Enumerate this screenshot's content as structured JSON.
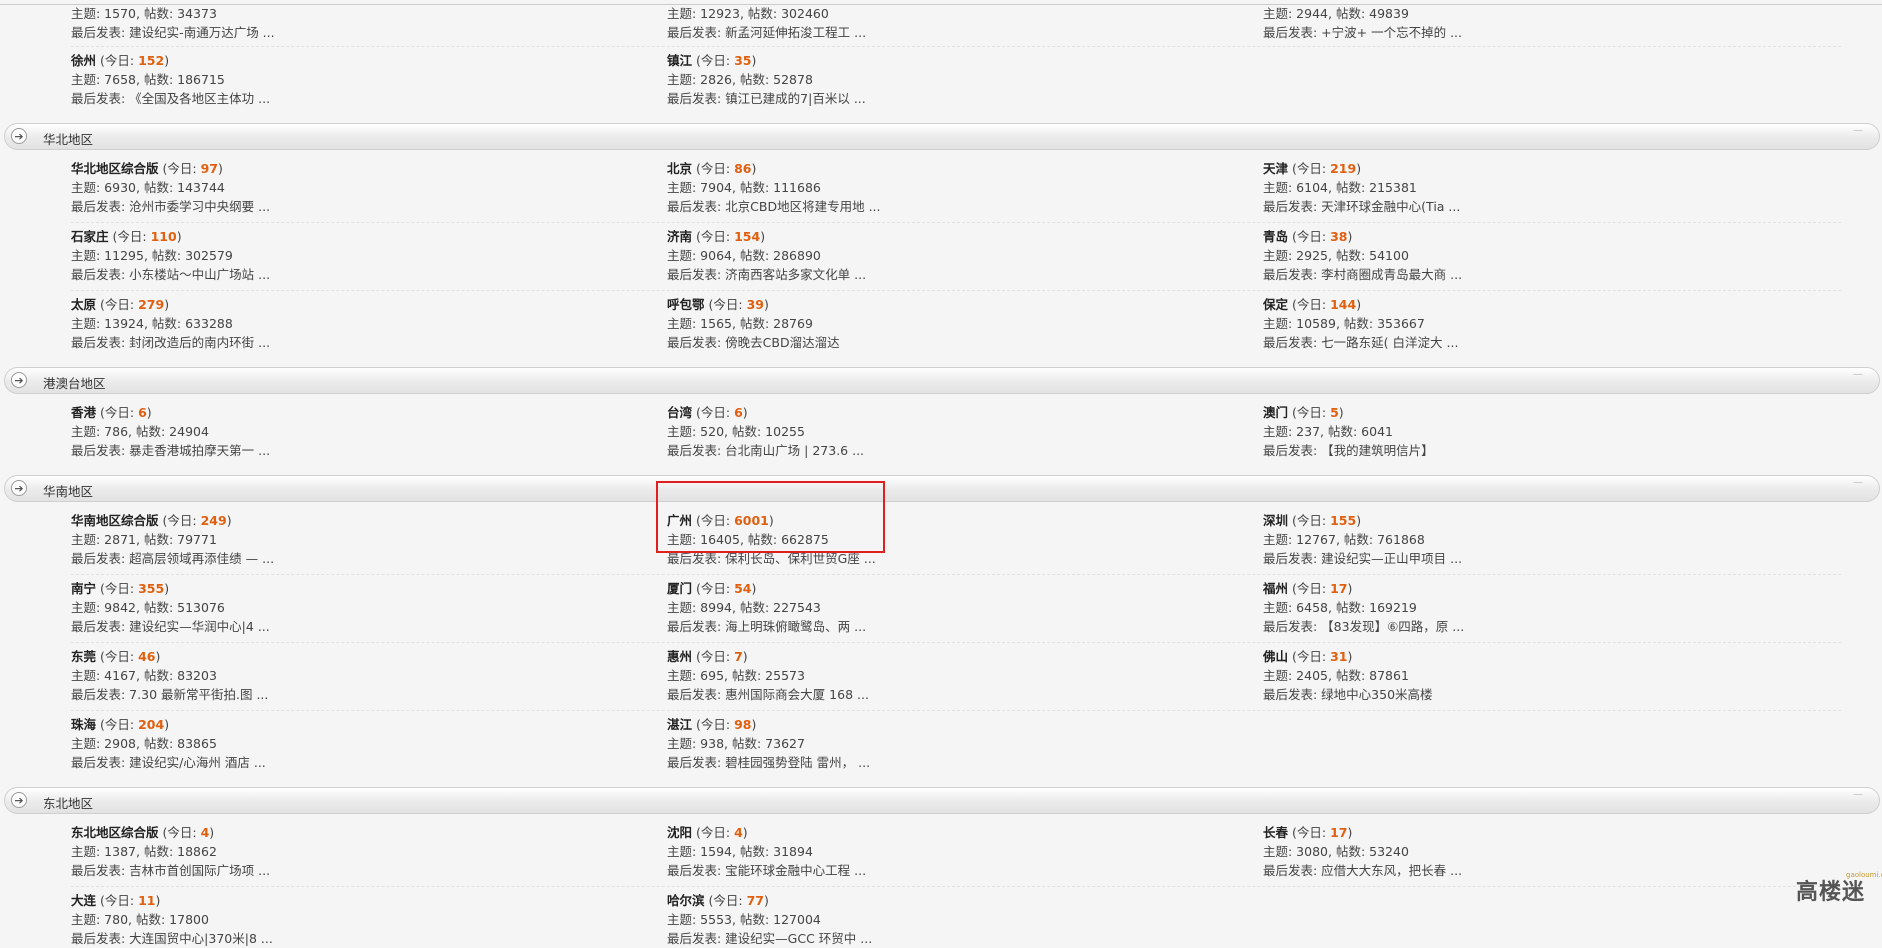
{
  "top_rows": [
    {
      "stats": "主题: 1570, 帖数: 34373",
      "last": "最后发表: 建设纪实-南通万达广场 ..."
    },
    {
      "stats": "主题: 12923, 帖数: 302460",
      "last": "最后发表: 新孟河延伸拓浚工程工 ..."
    },
    {
      "stats": "主题: 2944, 帖数: 49839",
      "last": "最后发表: +宁波+ 一个忘不掉的 ..."
    }
  ],
  "regions": [
    {
      "title": "",
      "forums": [
        {
          "name": "徐州",
          "today_count": "152",
          "stats": "主题: 7658, 帖数: 186715",
          "last": "最后发表: 《全国及各地区主体功 ..."
        },
        {
          "name": "镇江",
          "today_count": "35",
          "stats": "主题: 2826, 帖数: 52878",
          "last": "最后发表: 镇江已建成的7|百米以 ..."
        }
      ]
    },
    {
      "title": "华北地区",
      "forums": [
        {
          "name": "华北地区综合版",
          "today_count": "97",
          "stats": "主题: 6930, 帖数: 143744",
          "last": "最后发表: 沧州市委学习中央纲要 ..."
        },
        {
          "name": "北京",
          "today_count": "86",
          "stats": "主题: 7904, 帖数: 111686",
          "last": "最后发表: 北京CBD地区将建专用地 ..."
        },
        {
          "name": "天津",
          "today_count": "219",
          "stats": "主题: 6104, 帖数: 215381",
          "last": "最后发表: 天津环球金融中心(Tia ..."
        },
        {
          "name": "石家庄",
          "today_count": "110",
          "stats": "主题: 11295, 帖数: 302579",
          "last": "最后发表: 小东楼站～中山广场站 ..."
        },
        {
          "name": "济南",
          "today_count": "154",
          "stats": "主题: 9064, 帖数: 286890",
          "last": "最后发表: 济南西客站多家文化单 ..."
        },
        {
          "name": "青岛",
          "today_count": "38",
          "stats": "主题: 2925, 帖数: 54100",
          "last": "最后发表: 李村商圈成青岛最大商 ..."
        },
        {
          "name": "太原",
          "today_count": "279",
          "stats": "主题: 13924, 帖数: 633288",
          "last": "最后发表: 封闭改造后的南内环街 ..."
        },
        {
          "name": "呼包鄂",
          "today_count": "39",
          "stats": "主题: 1565, 帖数: 28769",
          "last": "最后发表: 傍晚去CBD溜达溜达"
        },
        {
          "name": "保定",
          "today_count": "144",
          "stats": "主题: 10589, 帖数: 353667",
          "last": "最后发表: 七一路东延( 白洋淀大 ..."
        }
      ]
    },
    {
      "title": "港澳台地区",
      "forums": [
        {
          "name": "香港",
          "today_count": "6",
          "stats": "主题: 786, 帖数: 24904",
          "last": "最后发表: 暴走香港城拍摩天第一 ..."
        },
        {
          "name": "台湾",
          "today_count": "6",
          "stats": "主题: 520, 帖数: 10255",
          "last": "最后发表: 台北南山广场 | 273.6 ..."
        },
        {
          "name": "澳门",
          "today_count": "5",
          "stats": "主题: 237, 帖数: 6041",
          "last": "最后发表: 【我的建筑明信片】"
        }
      ]
    },
    {
      "title": "华南地区",
      "forums": [
        {
          "name": "华南地区综合版",
          "today_count": "249",
          "stats": "主题: 2871, 帖数: 79771",
          "last": "最后发表: 超高层领域再添佳绩 — ..."
        },
        {
          "name": "广州",
          "today_count": "6001",
          "stats": "主题: 16405, 帖数: 662875",
          "last": "最后发表: 保利长岛、保利世贸G座 ..."
        },
        {
          "name": "深圳",
          "today_count": "155",
          "stats": "主题: 12767, 帖数: 761868",
          "last": "最后发表: 建设纪实—正山甲项目 ..."
        },
        {
          "name": "南宁",
          "today_count": "355",
          "stats": "主题: 9842, 帖数: 513076",
          "last": "最后发表: 建设纪实—华润中心|4 ..."
        },
        {
          "name": "厦门",
          "today_count": "54",
          "stats": "主题: 8994, 帖数: 227543",
          "last": "最后发表: 海上明珠俯瞰鹭岛、两 ..."
        },
        {
          "name": "福州",
          "today_count": "17",
          "stats": "主题: 6458, 帖数: 169219",
          "last": "最后发表: 【83发现】⑥四路，原 ..."
        },
        {
          "name": "东莞",
          "today_count": "46",
          "stats": "主题: 4167, 帖数: 83203",
          "last": "最后发表: 7.30 最新常平街拍.图 ..."
        },
        {
          "name": "惠州",
          "today_count": "7",
          "stats": "主题: 695, 帖数: 25573",
          "last": "最后发表: 惠州国际商会大厦 168 ..."
        },
        {
          "name": "佛山",
          "today_count": "31",
          "stats": "主题: 2405, 帖数: 87861",
          "last": "最后发表: 绿地中心350米高楼"
        },
        {
          "name": "珠海",
          "today_count": "204",
          "stats": "主题: 2908, 帖数: 83865",
          "last": "最后发表: 建设纪实/心海州 酒店 ..."
        },
        {
          "name": "湛江",
          "today_count": "98",
          "stats": "主题: 938, 帖数: 73627",
          "last": "最后发表: 碧桂园强势登陆 雷州， ..."
        }
      ]
    },
    {
      "title": "东北地区",
      "forums": [
        {
          "name": "东北地区综合版",
          "today_count": "4",
          "stats": "主题: 1387, 帖数: 18862",
          "last": "最后发表: 吉林市首创国际广场项 ..."
        },
        {
          "name": "沈阳",
          "today_count": "4",
          "stats": "主题: 1594, 帖数: 31894",
          "last": "最后发表: 宝能环球金融中心工程 ..."
        },
        {
          "name": "长春",
          "today_count": "17",
          "stats": "主题: 3080, 帖数: 53240",
          "last": "最后发表: 应借大大东风，把长春 ..."
        },
        {
          "name": "大连",
          "today_count": "11",
          "stats": "主题: 780, 帖数: 17800",
          "last": "最后发表: 大连国贸中心|370米|8 ..."
        },
        {
          "name": "哈尔滨",
          "today_count": "77",
          "stats": "主题: 5553, 帖数: 127004",
          "last": "最后发表: 建设纪实—GCC 环贸中 ..."
        }
      ]
    }
  ],
  "today_label": "今日",
  "logo": {
    "text": "高楼迷",
    "sub": "gaoloumi.com"
  },
  "colors": {
    "count": "#e06010",
    "highlight": "#e02020"
  }
}
